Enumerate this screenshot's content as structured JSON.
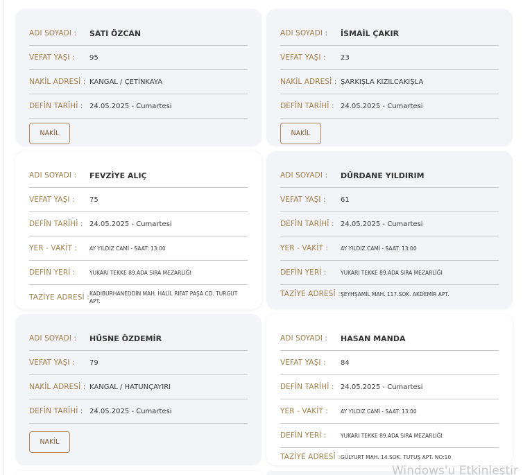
{
  "labels": {
    "name": "ADI SOYADI :",
    "age": "VEFAT YAŞI :",
    "nakil": "NAKİL ADRESİ :",
    "defin_tarihi": "DEFİN TARİHİ :",
    "yer_vakit": "YER - VAKİT :",
    "defin_yeri": "DEFİN YERİ :",
    "taziye": "TAZİYE ADRESİ :"
  },
  "nakil_button": "NAKİL",
  "cards": [
    {
      "name": "SATI ÖZCAN",
      "age": "95",
      "nakil": "KANGAL / ÇETİNKAYA",
      "defin_tarihi": "24.05.2025 - Cumartesi"
    },
    {
      "name": "İSMAİL ÇAKIR",
      "age": "23",
      "nakil": "ŞARKIŞLA KIZILCAKIŞLA",
      "defin_tarihi": "24.05.2025 - Cumartesi"
    },
    {
      "name": "FEVZİYE ALIÇ",
      "age": "75",
      "defin_tarihi": "24.05.2025 - Cumartesi",
      "yer_vakit": "AY YILDIZ CAMİ - SAAT: 13:00",
      "defin_yeri": "YUKARI TEKKE 89.ADA SIRA MEZARLIĞI",
      "taziye": "KADIBURHANEDDİN MAH. HALİL RIFAT PAŞA CD. TURGUT APT."
    },
    {
      "name": "DÜRDANE YILDIRIM",
      "age": "61",
      "defin_tarihi": "24.05.2025 - Cumartesi",
      "yer_vakit": "AY YILDIZ CAMİ - SAAT: 13:00",
      "defin_yeri": "YUKARI TEKKE 89.ADA SIRA MEZARLIĞI",
      "taziye": "ŞEYHŞAMİL MAH. 117.SOK. AKDEMİR APT."
    },
    {
      "name": "HÜSNE ÖZDEMİR",
      "age": "79",
      "nakil": "KANGAL / HATUNÇAYIRI",
      "defin_tarihi": "24.05.2025 - Cumartesi"
    },
    {
      "name": "HASAN MANDA",
      "age": "84",
      "defin_tarihi": "24.05.2025 - Cumartesi",
      "yer_vakit": "AY YILDIZ CAMİ - SAAT: 13:00",
      "defin_yeri": "YUKARI TEKKE 89.ADA SIRA MEZARLIĞI",
      "taziye": "GÜLYURT MAH. 14.SOK. TUTUŞ APT. NO:10"
    }
  ],
  "watermark": "Windows'u Etkinleştir"
}
